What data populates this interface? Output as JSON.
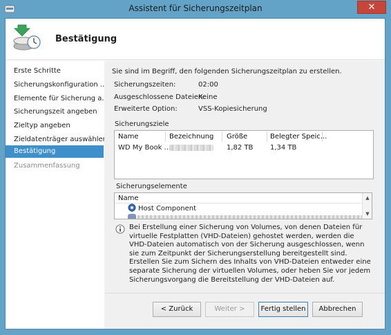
{
  "window": {
    "title": "Assistent für Sicherungszeitplan",
    "close_glyph": "✕"
  },
  "header": {
    "title": "Bestätigung",
    "icon": "backup-schedule-icon"
  },
  "nav": {
    "items": [
      {
        "label": "Erste Schritte",
        "state": "normal"
      },
      {
        "label": "Sicherungskonfiguration ...",
        "state": "normal"
      },
      {
        "label": "Elemente für Sicherung a...",
        "state": "normal"
      },
      {
        "label": "Sicherungszeit angeben",
        "state": "normal"
      },
      {
        "label": "Zieltyp angeben",
        "state": "normal"
      },
      {
        "label": "Zieldatenträger auswählen",
        "state": "normal"
      },
      {
        "label": "Bestätigung",
        "state": "selected"
      },
      {
        "label": "Zusammenfassung",
        "state": "disabled"
      }
    ]
  },
  "content": {
    "intro": "Sie sind im Begriff, den folgenden Sicherungszeitplan zu erstellen.",
    "summary": [
      {
        "label": "Sicherungszeiten:",
        "value": "02:00"
      },
      {
        "label": "Ausgeschlossene Dateien:",
        "value": "Keine"
      },
      {
        "label": "Erweiterte Option:",
        "value": "VSS-Kopiesicherung"
      }
    ],
    "targets": {
      "group_label": "Sicherungsziele",
      "columns": [
        "Name",
        "Bezeichnung",
        "Größe",
        "Belegter Speic..."
      ],
      "rows": [
        {
          "name": "WD My Book ...",
          "label_hidden": true,
          "size": "1,82 TB",
          "used": "1,34 TB"
        }
      ]
    },
    "elements": {
      "group_label": "Sicherungselemente",
      "columns": [
        "Name"
      ],
      "rows": [
        {
          "name": "Host Component",
          "icon": "gear-component-icon"
        }
      ]
    },
    "info": {
      "icon": "info-icon",
      "text": "Bei Erstellung einer Sicherung von Volumes, von denen Dateien für virtuelle Festplatten (VHD-Dateien) gehostet werden, werden die VHD-Dateien automatisch von der Sicherung ausgeschlossen, wenn sie zum Zeitpunkt der Sicherungserstellung bereitgestellt sind. Erstellen Sie zum Sichern des Inhalts von VHD-Dateien entweder eine separate Sicherung der virtuellen Volumes, oder heben Sie vor jedem Sicherungsvorgang die Bereitstellung der VHD-Dateien auf."
    }
  },
  "buttons": {
    "back": "< Zurück",
    "next": "Weiter >",
    "finish": "Fertig stellen",
    "cancel": "Abbrechen"
  }
}
